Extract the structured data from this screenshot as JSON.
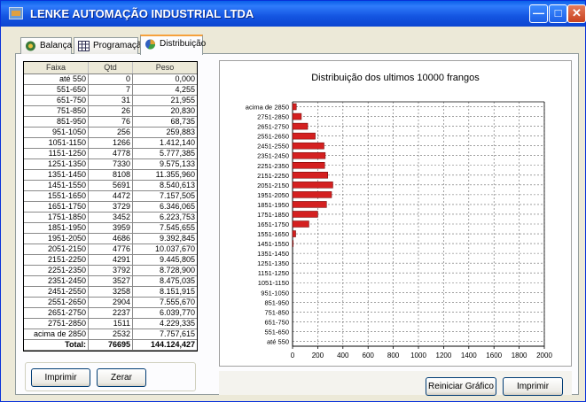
{
  "window": {
    "title": "LENKE AUTOMAÇÃO INDUSTRIAL LTDA",
    "controls": [
      "minimize",
      "maximize",
      "close"
    ]
  },
  "tabs": [
    {
      "label": "Balança",
      "icon": "scale-icon",
      "active": false
    },
    {
      "label": "Programação",
      "icon": "grid-icon",
      "active": false
    },
    {
      "label": "Distribuição",
      "icon": "pie-icon",
      "active": true
    }
  ],
  "table": {
    "headers": [
      "Faixa",
      "Qtd",
      "Peso"
    ],
    "rows": [
      [
        "até 550",
        "0",
        "0,000"
      ],
      [
        "551-650",
        "7",
        "4,255"
      ],
      [
        "651-750",
        "31",
        "21,955"
      ],
      [
        "751-850",
        "26",
        "20,830"
      ],
      [
        "851-950",
        "76",
        "68,735"
      ],
      [
        "951-1050",
        "256",
        "259,883"
      ],
      [
        "1051-1150",
        "1266",
        "1.412,140"
      ],
      [
        "1151-1250",
        "4778",
        "5.777,385"
      ],
      [
        "1251-1350",
        "7330",
        "9.575,133"
      ],
      [
        "1351-1450",
        "8108",
        "11.355,960"
      ],
      [
        "1451-1550",
        "5691",
        "8.540,613"
      ],
      [
        "1551-1650",
        "4472",
        "7.157,505"
      ],
      [
        "1651-1750",
        "3729",
        "6.346,065"
      ],
      [
        "1751-1850",
        "3452",
        "6.223,753"
      ],
      [
        "1851-1950",
        "3959",
        "7.545,655"
      ],
      [
        "1951-2050",
        "4686",
        "9.392,845"
      ],
      [
        "2051-2150",
        "4776",
        "10.037,670"
      ],
      [
        "2151-2250",
        "4291",
        "9.445,805"
      ],
      [
        "2251-2350",
        "3792",
        "8.728,900"
      ],
      [
        "2351-2450",
        "3527",
        "8.475,035"
      ],
      [
        "2451-2550",
        "3258",
        "8.151,915"
      ],
      [
        "2551-2650",
        "2904",
        "7.555,670"
      ],
      [
        "2651-2750",
        "2237",
        "6.039,770"
      ],
      [
        "2751-2850",
        "1511",
        "4.229,335"
      ],
      [
        "acima de 2850",
        "2532",
        "7.757,615"
      ]
    ],
    "total": {
      "label": "Total:",
      "qtd": "76695",
      "peso": "144.124,427"
    }
  },
  "buttons": {
    "print_left": "Imprimir",
    "reset": "Zerar",
    "restart_chart": "Reiniciar Gráfico",
    "print_right": "Imprimir"
  },
  "colors": {
    "bar": "#d42020",
    "titlebar": "#0a5fe8",
    "active_tab_accent": "#f6a13c"
  },
  "chart_data": {
    "type": "bar",
    "orientation": "horizontal",
    "title": "Distribuição dos ultimos 10000 frangos",
    "categories": [
      "acima de 2850",
      "2751-2850",
      "2651-2750",
      "2551-2650",
      "2451-2550",
      "2351-2450",
      "2251-2350",
      "2151-2250",
      "2051-2150",
      "1951-2050",
      "1851-1950",
      "1751-1850",
      "1651-1750",
      "1551-1650",
      "1451-1550",
      "1351-1450",
      "1251-1350",
      "1151-1250",
      "1051-1150",
      "951-1050",
      "851-950",
      "751-850",
      "651-750",
      "551-650",
      "até 550"
    ],
    "values": [
      30,
      70,
      120,
      180,
      250,
      260,
      255,
      280,
      320,
      310,
      270,
      200,
      130,
      25,
      5,
      0,
      0,
      0,
      0,
      0,
      0,
      0,
      0,
      0,
      0
    ],
    "xticks": [
      0,
      200,
      400,
      600,
      800,
      1000,
      1200,
      1400,
      1600,
      1800,
      2000
    ],
    "xlim": [
      0,
      2000
    ],
    "grid": true
  }
}
